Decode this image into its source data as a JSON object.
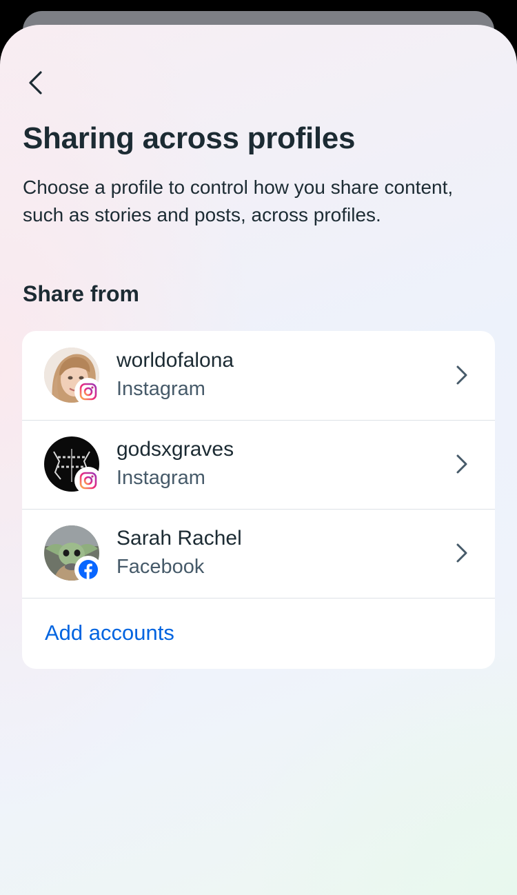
{
  "header": {
    "title": "Sharing across profiles",
    "description": "Choose a profile to control how you share content, such as stories and posts, across profiles."
  },
  "section": {
    "label": "Share from"
  },
  "profiles": [
    {
      "name": "worldofalona",
      "platform": "Instagram",
      "avatar": "woman-with-blonde-hair-avatar",
      "badge_icon": "instagram-icon"
    },
    {
      "name": "godsxgraves",
      "platform": "Instagram",
      "avatar": "gods-and-graves-logo-avatar",
      "badge_icon": "instagram-icon"
    },
    {
      "name": "Sarah Rachel",
      "platform": "Facebook",
      "avatar": "baby-yoda-avatar",
      "badge_icon": "facebook-icon"
    }
  ],
  "actions": {
    "add_accounts": "Add accounts"
  },
  "colors": {
    "text_primary": "#1c2b33",
    "text_secondary": "#465a69",
    "link": "#0064e0",
    "facebook_blue": "#0866ff"
  }
}
